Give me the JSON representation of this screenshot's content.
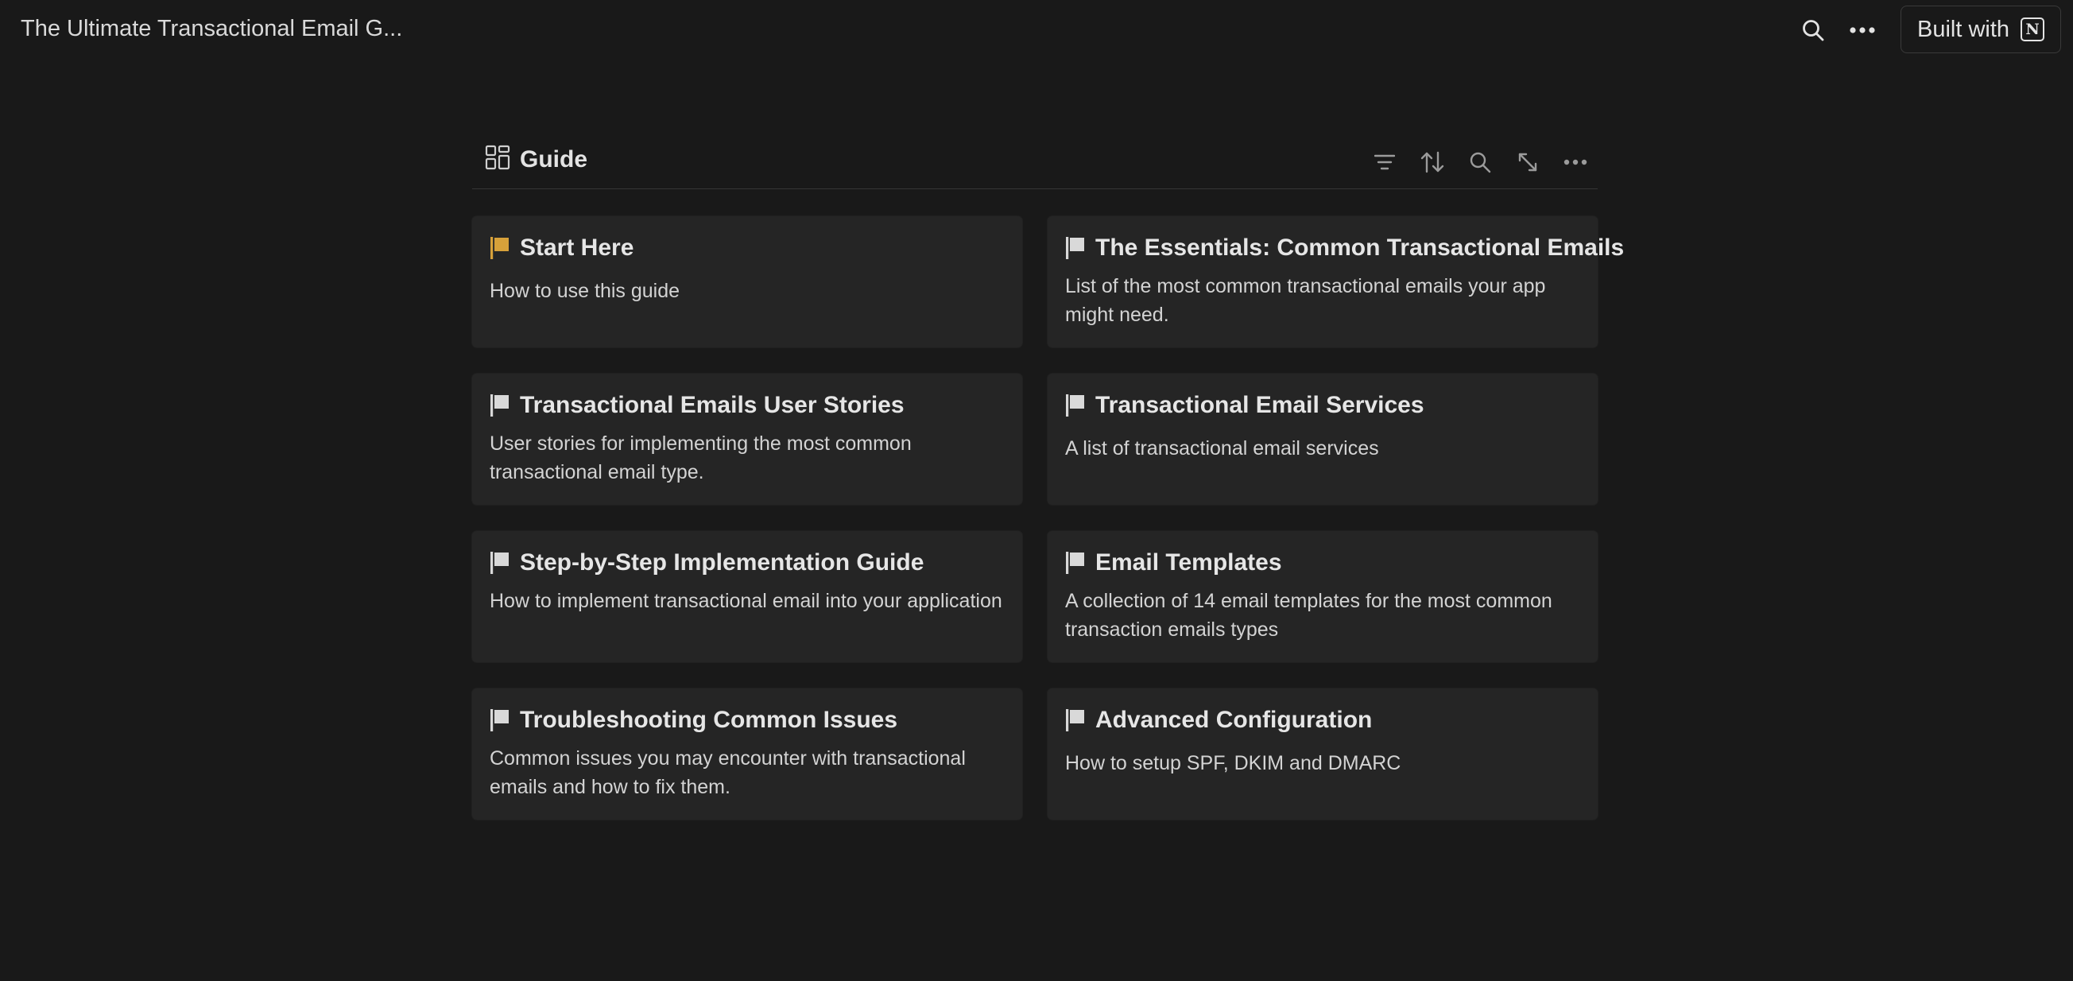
{
  "topbar": {
    "title": "The Ultimate Transactional Email G...",
    "search_icon": "search-icon",
    "more_icon": "more-horizontal-icon",
    "built_with_label": "Built with",
    "built_with_logo": "N"
  },
  "database": {
    "title": "Guide",
    "view_icon": "gallery-view-icon",
    "tools": [
      "filter-icon",
      "sort-icon",
      "search-icon",
      "expand-icon",
      "more-horizontal-icon"
    ]
  },
  "colors": {
    "background": "#191919",
    "card": "#252525",
    "accent_flag": "#d7a13a",
    "flag": "#d9d9d9"
  },
  "cards": [
    {
      "title": "Start Here",
      "description": "How to use this guide",
      "icon": "flag-icon",
      "flag_color": "#d7a13a"
    },
    {
      "title": "The Essentials: Common Transactional Emails",
      "description": "List of the most common transactional emails your app might need.",
      "icon": "flag-icon",
      "flag_color": "#d9d9d9"
    },
    {
      "title": "Transactional Emails User Stories",
      "description": "User stories for implementing the most common transactional email type.",
      "icon": "flag-icon",
      "flag_color": "#d9d9d9"
    },
    {
      "title": "Transactional Email Services",
      "description": "A list of transactional email services",
      "icon": "flag-icon",
      "flag_color": "#d9d9d9"
    },
    {
      "title": "Step-by-Step Implementation Guide",
      "description": "How to implement transactional email into your application",
      "icon": "flag-icon",
      "flag_color": "#d9d9d9"
    },
    {
      "title": "Email Templates",
      "description": "A collection of 14 email templates for the most common transaction emails types",
      "icon": "flag-icon",
      "flag_color": "#d9d9d9"
    },
    {
      "title": "Troubleshooting Common Issues",
      "description": "Common issues you may encounter with transactional emails and how to fix them.",
      "icon": "flag-icon",
      "flag_color": "#d9d9d9"
    },
    {
      "title": "Advanced Configuration",
      "description": "How to setup SPF, DKIM and DMARC",
      "icon": "flag-icon",
      "flag_color": "#d9d9d9"
    }
  ]
}
